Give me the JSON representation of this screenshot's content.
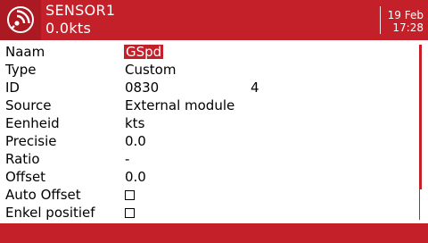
{
  "header": {
    "title": "SENSOR1",
    "value": "0.0kts",
    "date": "19 Feb",
    "time": "17:28",
    "icon": "telemetry-signal-icon"
  },
  "fields": [
    {
      "label": "Naam",
      "value": "GSpd"
    },
    {
      "label": "Type",
      "value": "Custom"
    },
    {
      "label": "ID",
      "value": "0830",
      "value2": "4"
    },
    {
      "label": "Source",
      "value": "External module"
    },
    {
      "label": "Eenheid",
      "value": "kts"
    },
    {
      "label": "Precisie",
      "value": "0.0"
    },
    {
      "label": "Ratio",
      "value": "-"
    },
    {
      "label": "Offset",
      "value": "0.0"
    },
    {
      "label": "Auto Offset",
      "checked": false
    },
    {
      "label": "Enkel positief",
      "checked": false
    }
  ],
  "colors": {
    "accent": "#c4202a",
    "accent_dark": "#ab1a22"
  }
}
